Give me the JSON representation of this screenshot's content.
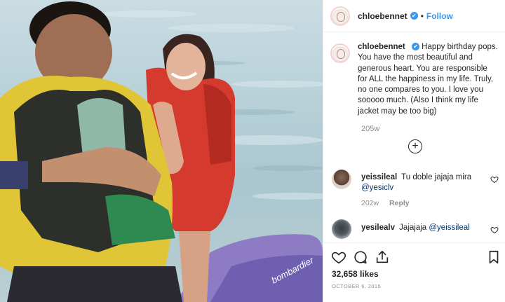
{
  "post": {
    "username": "chloebennet",
    "verified_badge": "✔",
    "separator": "•",
    "follow_label": "Follow",
    "caption": "Happy birthday pops. You have the most beautiful and generous heart. You are responsible for ALL the happiness in my life. Truly, no one compares to you. I love you sooooo much. (Also I think my life jacket may be too big)",
    "caption_age": "205w",
    "load_more_symbol": "+",
    "likes": "32,658 likes",
    "date": "OCTOBER 6, 2015"
  },
  "photo": {
    "banner_text": "bombardier"
  },
  "comments": [
    {
      "username": "yeissileal",
      "text": "Tu doble jajaja mira",
      "mention": "@yesiclv",
      "age": "202w",
      "reply_label": "Reply"
    },
    {
      "username": "yesilealv",
      "text": "Jajajaja",
      "mention": "@yeissileal"
    }
  ],
  "icons": {
    "like": "heart-icon",
    "comment": "comment-icon",
    "share": "share-icon",
    "save": "bookmark-icon",
    "comment_like": "heart-icon",
    "add": "plus-circle-icon"
  },
  "colors": {
    "link_blue": "#3897f0",
    "muted": "#8e8e8e",
    "text": "#262626",
    "divider": "#efefef"
  }
}
